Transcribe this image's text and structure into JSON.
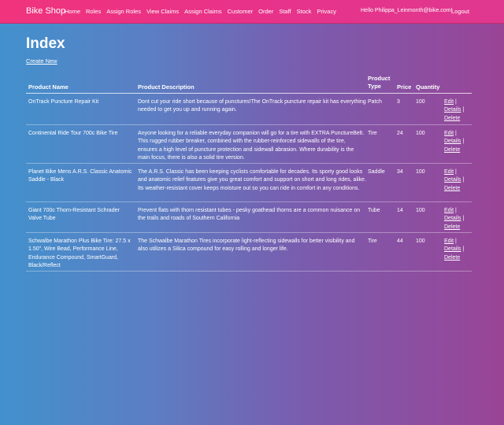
{
  "nav": {
    "brand": "Bike Shop",
    "links": [
      "Home",
      "Roles",
      "Assign Roles",
      "View Claims",
      "Assign Claims",
      "Customer",
      "Order",
      "Staff",
      "Stock",
      "Privacy"
    ],
    "hello": "Hello Philippa_Leinmonth@bike.com!",
    "logout": "Logout"
  },
  "page": {
    "title": "Index",
    "create_new": "Create New"
  },
  "table": {
    "headers": {
      "name": "Product Name",
      "desc": "Product Description",
      "type": "Product Type",
      "price": "Price",
      "qty": "Quantity"
    },
    "actions": {
      "edit": "Edit",
      "details": "Details",
      "delete": "Delete",
      "sep": "|"
    },
    "rows": [
      {
        "name": "OnTrack Puncture Repair Kit",
        "desc": "Dont cut your ride short because of punctures!The OnTrack puncture repair kit has everything needed to get you up and running again.",
        "type": "Patch",
        "price": "3",
        "qty": "100"
      },
      {
        "name": "Continental Ride Tour 700c Bike Tire",
        "desc": "Anyone looking for a reliable everyday companion will go for a tire with EXTRA PunctureBelt. This rugged rubber breaker, combined with the rubber-reinforced sidewalls of the tire, ensures a high level of puncture protection and sidewall abrasion. Where durability is the main focus, there is also a solid tire version.",
        "type": "Tire",
        "price": "24",
        "qty": "100"
      },
      {
        "name": "Planet Bike Mens A.R.S. Classic Anatomic Saddle - Black",
        "desc": "The A.R.S. Classic has been keeping cyclists comfortable for decades. Its sporty good looks and anatomic relief features give you great comfort and support on short and long rides, alike. Its weather-resistant cover keeps moisture out so you can ride in comfort in any conditions.",
        "type": "Saddle",
        "price": "34",
        "qty": "100"
      },
      {
        "name": "Giant 700c Thorn-Resistant Schrader Valve Tube",
        "desc": "Prevent flats with thorn resistant tubes - pesky goathead thorns are a common nuisance on the trails and roads of Southern California",
        "type": "Tube",
        "price": "14",
        "qty": "100"
      },
      {
        "name": "Schwalbe Marathon Plus Bike Tire: 27.5 x 1.50\", Wire Bead, Performance Line, Endurance Compound, SmartGuard, Black/Reflect",
        "desc": "The Schwalbe Marathon Tires incorporate light-reflecting sidewalls for better visibility and also utilizes a Silica compound for easy rolling and longer life.",
        "type": "Tire",
        "price": "44",
        "qty": "100"
      }
    ]
  }
}
